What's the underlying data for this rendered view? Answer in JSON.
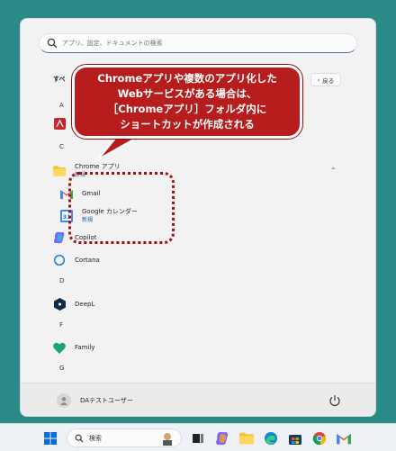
{
  "search": {
    "placeholder": "アプリ、設定、ドキュメントの検索"
  },
  "header": {
    "all_apps": "すべ",
    "back_label": "戻る"
  },
  "letters": [
    "A",
    "C",
    "D",
    "F",
    "G"
  ],
  "apps": {
    "chrome_folder": {
      "name": "Chrome アプリ",
      "badge": "新規"
    },
    "gmail": {
      "name": "Gmail"
    },
    "google_calendar": {
      "name": "Google カレンダー",
      "badge": "新規",
      "icon_text": "31"
    },
    "copilot": {
      "name": "Copilot"
    },
    "cortana": {
      "name": "Cortana"
    },
    "deepl": {
      "name": "DeepL"
    },
    "family": {
      "name": "Family"
    }
  },
  "user": {
    "name": "DAテストユーザー"
  },
  "callout": {
    "line1": "Chromeアプリや複数のアプリ化した",
    "line2": "Webサービスがある場合は、",
    "line3": "［Chromeアプリ］フォルダ内に",
    "line4": "ショートカットが作成される"
  },
  "taskbar": {
    "search_label": "検索"
  },
  "colors": {
    "desktop": "#2a8a88",
    "callout": "#b81d1d",
    "accent_blue": "#1a5fb4"
  },
  "icons": [
    "search-icon",
    "start-icon",
    "power-icon",
    "avatar-icon",
    "chrome-icon",
    "edge-icon",
    "gmail-icon",
    "folder-icon"
  ]
}
